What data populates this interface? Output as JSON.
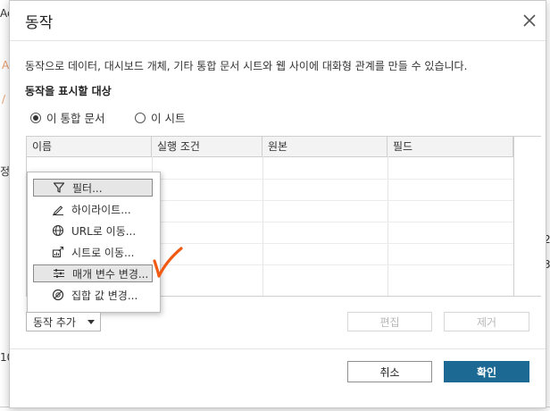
{
  "background": {
    "fragments": [
      "Ac",
      "A",
      "/",
      "정",
      "10",
      "2",
      "3"
    ]
  },
  "dialog": {
    "title": "동작",
    "description": "동작으로 데이터, 대시보드 개체, 기타 통합 문서 시트와 웹 사이에 대화형 관계를 만들 수 있습니다.",
    "section_label": "동작을 표시할 대상",
    "radios": [
      {
        "label": "이 통합 문서",
        "checked": true
      },
      {
        "label": "이 시트",
        "checked": false
      }
    ],
    "table": {
      "headers": [
        "이름",
        "실행 조건",
        "원본",
        "필드"
      ]
    },
    "menu": {
      "items": [
        {
          "label": "필터...",
          "icon": "filter-icon",
          "selected": true
        },
        {
          "label": "하이라이트...",
          "icon": "highlight-pen-icon",
          "selected": false
        },
        {
          "label": "URL로 이동...",
          "icon": "globe-icon",
          "selected": false
        },
        {
          "label": "시트로 이동...",
          "icon": "go-to-sheet-icon",
          "selected": false
        },
        {
          "label": "매개 변수 변경...",
          "icon": "parameter-icon",
          "selected": true
        },
        {
          "label": "집합 값 변경...",
          "icon": "set-icon",
          "selected": false
        }
      ]
    },
    "add_action_label": "동작 추가",
    "edit_label": "편집",
    "remove_label": "제거",
    "cancel_label": "취소",
    "ok_label": "확인",
    "colors": {
      "ok_button": "#1c6a93",
      "annotation": "#f05a14"
    }
  }
}
